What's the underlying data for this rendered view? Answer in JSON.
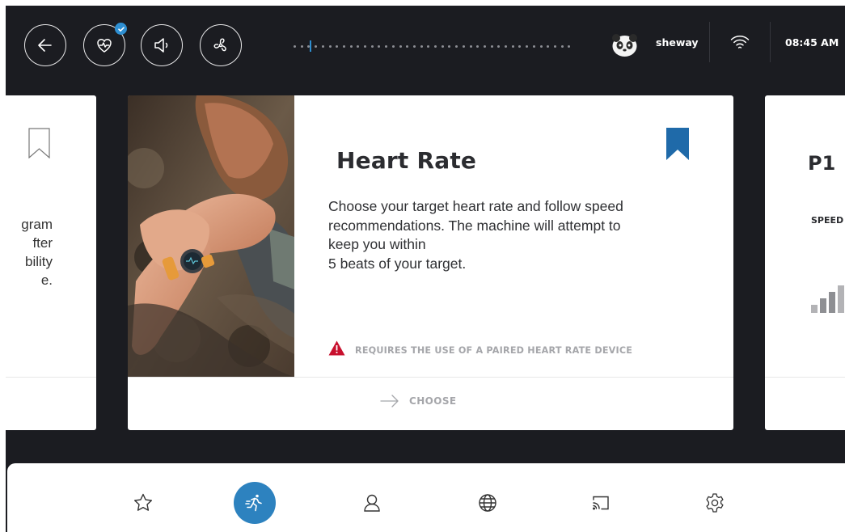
{
  "topbar": {
    "buttons": [
      {
        "name": "back",
        "icon": "arrow-left-icon"
      },
      {
        "name": "heart-rate-monitor",
        "icon": "heart-pulse-icon",
        "badge": "check-icon"
      },
      {
        "name": "volume",
        "icon": "speaker-icon"
      },
      {
        "name": "fan",
        "icon": "fan-icon"
      }
    ],
    "username": "sheway",
    "time": "08:45 AM",
    "wifi_icon": "wifi-icon"
  },
  "cards": {
    "left": {
      "description": "gram\nfter\nbility\ne."
    },
    "main": {
      "title": "Heart Rate",
      "description": "Choose your target heart rate and follow speed recommendations. The machine will attempt to keep you within 5 beats of your target.",
      "description_lines": [
        "Choose your target heart rate and follow speed",
        "recommendations. The machine will attempt to",
        "keep you within",
        "5 beats of your target."
      ],
      "warning": "REQUIRES THE USE OF A PAIRED HEART RATE DEVICE",
      "action_label": "CHOOSE",
      "bookmarked": true
    },
    "right": {
      "title": "P1",
      "subtitle": "SPEED"
    }
  },
  "bottom_nav": {
    "items": [
      {
        "name": "favorites",
        "icon": "star-icon",
        "active": false
      },
      {
        "name": "workouts",
        "icon": "running-icon",
        "active": true
      },
      {
        "name": "profile",
        "icon": "user-icon",
        "active": false
      },
      {
        "name": "internet",
        "icon": "globe-icon",
        "active": false
      },
      {
        "name": "screen-mirror",
        "icon": "cast-icon",
        "active": false
      },
      {
        "name": "settings",
        "icon": "gear-icon",
        "active": false
      }
    ]
  },
  "colors": {
    "background": "#1b1c21",
    "accent": "#2d82bf",
    "warning": "#c8102e",
    "muted_text": "#a5a6aa"
  }
}
